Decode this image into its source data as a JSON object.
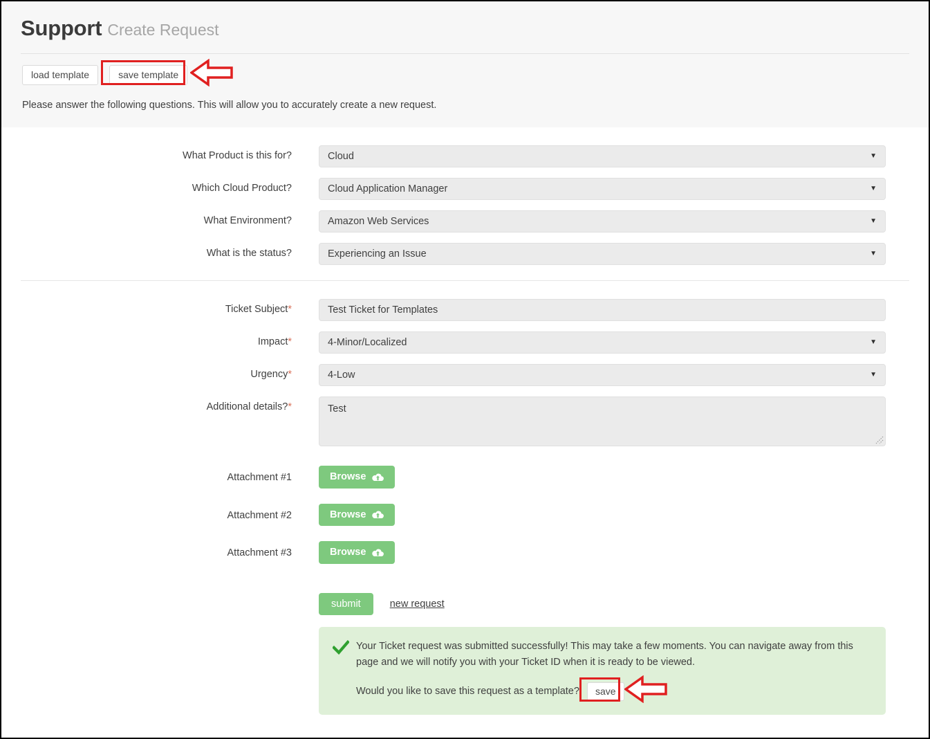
{
  "header": {
    "title": "Support",
    "subtitle": "Create Request",
    "load_template_label": "load template",
    "save_template_label": "save template",
    "intro": "Please answer the following questions. This will allow you to accurately create a new request."
  },
  "form": {
    "section1": [
      {
        "label": "What Product is this for?",
        "value": "Cloud",
        "type": "select"
      },
      {
        "label": "Which Cloud Product?",
        "value": "Cloud Application Manager",
        "type": "select"
      },
      {
        "label": "What Environment?",
        "value": "Amazon Web Services",
        "type": "select"
      },
      {
        "label": "What is the status?",
        "value": "Experiencing an Issue",
        "type": "select"
      }
    ],
    "section2": [
      {
        "label": "Ticket Subject",
        "required": "*",
        "value": "Test Ticket for Templates",
        "type": "text"
      },
      {
        "label": "Impact",
        "required": "*",
        "value": "4-Minor/Localized",
        "type": "select"
      },
      {
        "label": "Urgency",
        "required": "*",
        "value": "4-Low",
        "type": "select"
      },
      {
        "label": "Additional details?",
        "required": "*",
        "value": "Test",
        "type": "textarea"
      }
    ],
    "attachments": [
      {
        "label": "Attachment #1",
        "button": "Browse"
      },
      {
        "label": "Attachment #2",
        "button": "Browse"
      },
      {
        "label": "Attachment #3",
        "button": "Browse"
      }
    ],
    "caret_glyph": "▼"
  },
  "actions": {
    "submit_label": "submit",
    "new_request_label": "new request"
  },
  "alert": {
    "message": "Your Ticket request was submitted successfully! This may take a few moments. You can navigate away from this page and we will notify you with your Ticket ID when it is ready to be viewed.",
    "prompt": "Would you like to save this request as a template?",
    "save_label": "save"
  },
  "colors": {
    "accent_green": "#7ec97e",
    "alert_bg": "#dff0d8",
    "annotation_red": "#e02020",
    "field_bg": "#ebebeb",
    "header_bg": "#f7f7f7",
    "required_asterisk": "#d9725a"
  }
}
